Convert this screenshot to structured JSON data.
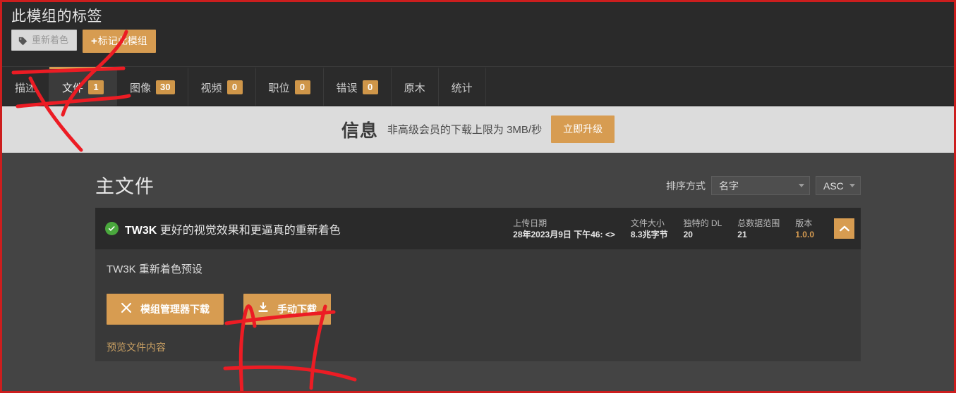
{
  "header": {
    "tags_title": "此模组的标签",
    "recolor_button": "重新着色",
    "flag_button": "标记此模组",
    "flag_plus": "+"
  },
  "tabs": [
    {
      "label": "描述",
      "count": null,
      "active": false
    },
    {
      "label": "文件",
      "count": "1",
      "active": true
    },
    {
      "label": "图像",
      "count": "30",
      "active": false
    },
    {
      "label": "视频",
      "count": "0",
      "active": false
    },
    {
      "label": "职位",
      "count": "0",
      "active": false
    },
    {
      "label": "错误",
      "count": "0",
      "active": false
    },
    {
      "label": "原木",
      "count": null,
      "active": false
    },
    {
      "label": "统计",
      "count": null,
      "active": false
    }
  ],
  "banner": {
    "word": "信息",
    "text": "非高级会员的下载上限为 3MB/秒",
    "upgrade_button": "立即升级"
  },
  "main": {
    "section_title": "主文件",
    "sort_label": "排序方式",
    "sort_field": "名字",
    "sort_direction": "ASC"
  },
  "file": {
    "title_bold": "TW3K",
    "title_rest": "更好的视觉效果和更逼真的重新着色",
    "meta": [
      {
        "label": "上传日期",
        "value": "28年2023月9日 下午46: <>",
        "accent": false
      },
      {
        "label": "文件大小",
        "value": "8.3兆字节",
        "accent": false
      },
      {
        "label": "独特的 DL",
        "value": "20",
        "accent": false
      },
      {
        "label": "总数据范围",
        "value": "21",
        "accent": false
      },
      {
        "label": "版本",
        "value": "1.0.0",
        "accent": true
      }
    ],
    "detail_name": "TW3K 重新着色预设",
    "mod_manager_button": "模组管理器下载",
    "manual_button": "手动下载",
    "preview_link": "预览文件内容"
  },
  "colors": {
    "accent_orange": "#d79c51",
    "page_dark": "#2a2a2a",
    "content_gray": "#444444",
    "panel_gray": "#393939",
    "banner_gray": "#dcdcdc",
    "success_green": "#4aa83d",
    "annotation_red": "#cc1e1e",
    "link_tan": "#c9a063"
  }
}
